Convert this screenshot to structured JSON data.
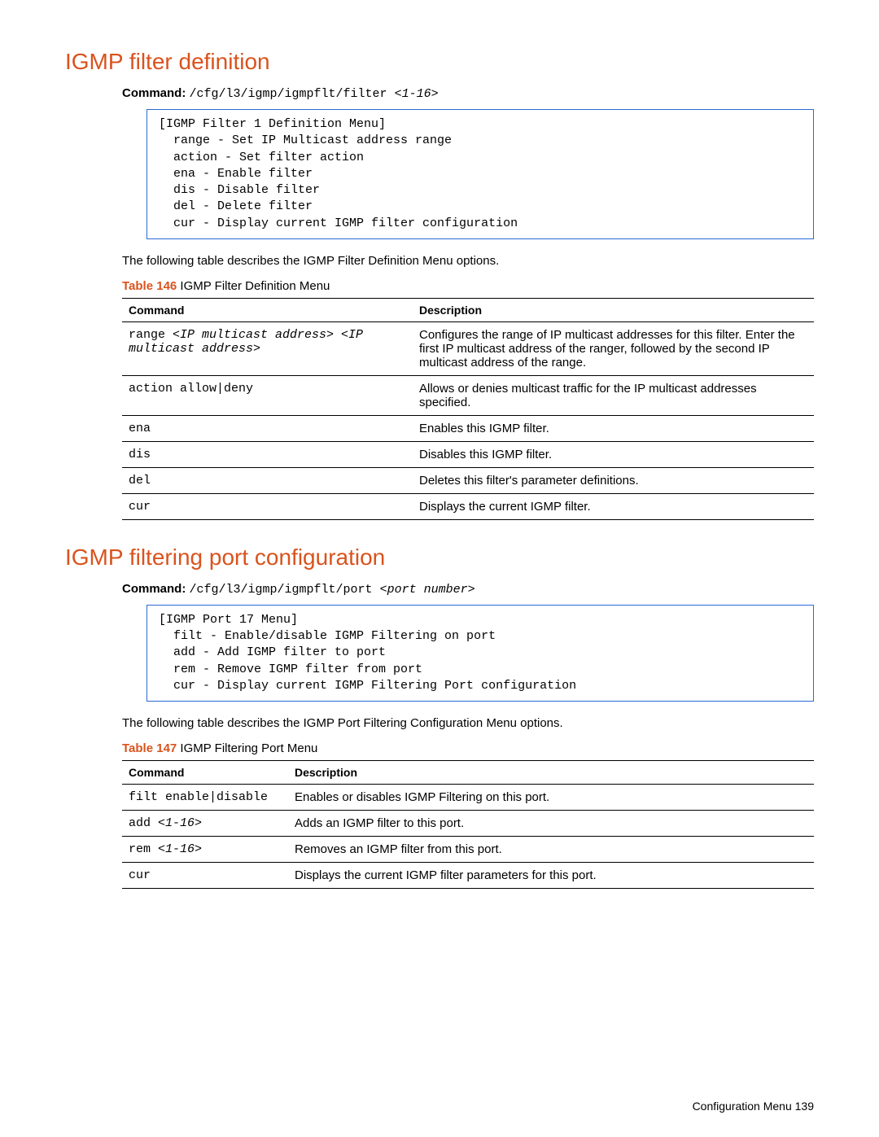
{
  "section1": {
    "heading": "IGMP filter definition",
    "command_label": "Command:",
    "command_path": "/cfg/l3/igmp/igmpflt/filter ",
    "command_arg": "<1-16>",
    "code_box": "[IGMP Filter 1 Definition Menu]\n  range - Set IP Multicast address range\n  action - Set filter action\n  ena - Enable filter\n  dis - Disable filter\n  del - Delete filter\n  cur - Display current IGMP filter configuration",
    "intro": "The following table describes the IGMP Filter Definition Menu options.",
    "table_caption_num": "Table 146",
    "table_caption_text": "  IGMP Filter Definition Menu",
    "header_cmd": "Command",
    "header_desc": "Description",
    "rows": [
      {
        "cmd_pre": "range ",
        "cmd_arg": "<IP multicast address> <IP multicast address>",
        "desc": "Configures the range of IP multicast addresses for this filter. Enter the first IP multicast address of the ranger, followed by the second IP multicast address of the range."
      },
      {
        "cmd_pre": "action allow|deny",
        "cmd_arg": "",
        "desc": "Allows or denies multicast traffic for the IP multicast addresses specified."
      },
      {
        "cmd_pre": "ena",
        "cmd_arg": "",
        "desc": "Enables this IGMP filter."
      },
      {
        "cmd_pre": "dis",
        "cmd_arg": "",
        "desc": "Disables this IGMP filter."
      },
      {
        "cmd_pre": "del",
        "cmd_arg": "",
        "desc": "Deletes this filter's parameter definitions."
      },
      {
        "cmd_pre": "cur",
        "cmd_arg": "",
        "desc": "Displays the current IGMP filter."
      }
    ]
  },
  "section2": {
    "heading": "IGMP filtering port configuration",
    "command_label": "Command:",
    "command_path": "/cfg/l3/igmp/igmpflt/port ",
    "command_arg": "<port number>",
    "code_box": "[IGMP Port 17 Menu]\n  filt - Enable/disable IGMP Filtering on port\n  add - Add IGMP filter to port\n  rem - Remove IGMP filter from port\n  cur - Display current IGMP Filtering Port configuration",
    "intro": "The following table describes the IGMP Port Filtering Configuration Menu options.",
    "table_caption_num": "Table 147",
    "table_caption_text": "  IGMP Filtering Port Menu",
    "header_cmd": "Command",
    "header_desc": "Description",
    "rows": [
      {
        "cmd_pre": "filt enable|disable",
        "cmd_arg": "",
        "desc": "Enables or disables IGMP Filtering on this port."
      },
      {
        "cmd_pre": "add ",
        "cmd_arg": "<1-16>",
        "desc": "Adds an IGMP filter to this port."
      },
      {
        "cmd_pre": "rem ",
        "cmd_arg": "<1-16>",
        "desc": "Removes an IGMP filter from this port."
      },
      {
        "cmd_pre": "cur",
        "cmd_arg": "",
        "desc": "Displays the current IGMP filter parameters for this port."
      }
    ]
  },
  "footer": {
    "text": "Configuration Menu   139"
  }
}
